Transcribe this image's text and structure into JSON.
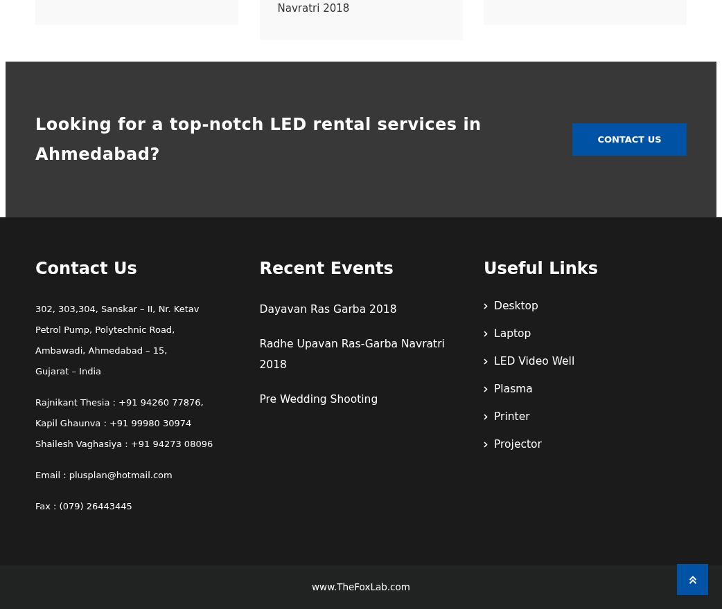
{
  "top_event_card": {
    "title": "Navratri 2018"
  },
  "cta": {
    "heading": "Looking for a top-notch LED rental services in Ahmedabad?",
    "button": "CONTACT US"
  },
  "footer": {
    "contact": {
      "title": "Contact Us",
      "address_lines": [
        "302, 303,304, Sanskar – II, Nr. Ketav",
        "Petrol Pump, Polytechnic Road,",
        "Ambawadi, Ahmedabad – 15,",
        "Gujarat – India"
      ],
      "phone_lines": [
        "Rajnikant Thesia : +91 94260 77876,",
        "Kapil Ghaunva : +91 99980 30974",
        "Shailesh Vaghasiya : +91 94273 08096"
      ],
      "email": "Email : plusplan@hotmail.com",
      "fax": "Fax : (079) 26443445"
    },
    "events": {
      "title": "Recent Events",
      "items": [
        "Dayavan Ras Garba 2018",
        "Radhe Upavan Ras-Garba Navratri 2018",
        "Pre Wedding Shooting"
      ]
    },
    "links": {
      "title": "Useful Links",
      "items": [
        "Desktop",
        "Laptop",
        "LED Video Well",
        "Plasma",
        "Printer",
        "Projector"
      ]
    }
  },
  "bottom_bar": {
    "credit": "www.TheFoxLab.com"
  }
}
